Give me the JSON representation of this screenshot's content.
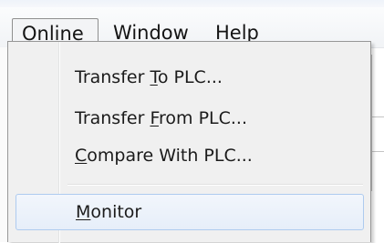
{
  "menubar": {
    "items": [
      {
        "label": "Online",
        "mnemonic": "O",
        "rest": "nline"
      },
      {
        "label": "Window",
        "mnemonic": "W",
        "rest": "indow"
      },
      {
        "label": "Help",
        "mnemonic": "H",
        "rest": "elp"
      }
    ]
  },
  "dropdown": {
    "items": [
      {
        "label": "Transfer To PLC...",
        "pre": "Transfer ",
        "mnemonic": "T",
        "post": "o PLC..."
      },
      {
        "label": "Transfer From PLC...",
        "pre": "Transfer ",
        "mnemonic": "F",
        "post": "rom PLC..."
      },
      {
        "label": "Compare With PLC...",
        "pre": "",
        "mnemonic": "C",
        "post": "ompare With PLC..."
      },
      {
        "label": "Monitor",
        "pre": "",
        "mnemonic": "M",
        "post": "onitor"
      }
    ]
  },
  "colors": {
    "highlight_border": "#aecbef",
    "menu_background": "#f0f0f0"
  }
}
